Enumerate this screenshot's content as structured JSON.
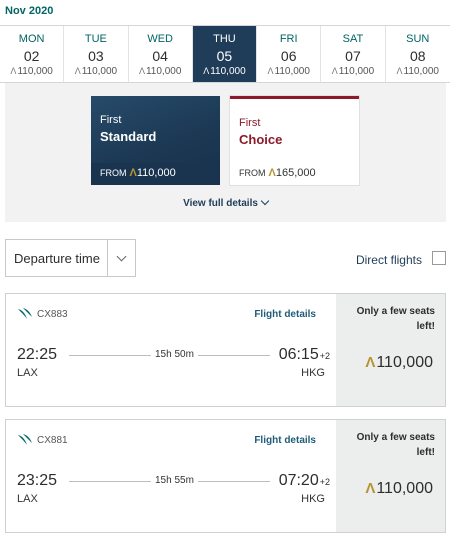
{
  "header": {
    "month": "Nov 2020"
  },
  "days": [
    {
      "dow": "MON",
      "date": "02",
      "price": "110,000",
      "selected": false
    },
    {
      "dow": "TUE",
      "date": "03",
      "price": "110,000",
      "selected": false
    },
    {
      "dow": "WED",
      "date": "04",
      "price": "110,000",
      "selected": false
    },
    {
      "dow": "THU",
      "date": "05",
      "price": "110,000",
      "selected": true
    },
    {
      "dow": "FRI",
      "date": "06",
      "price": "110,000",
      "selected": false
    },
    {
      "dow": "SAT",
      "date": "07",
      "price": "110,000",
      "selected": false
    },
    {
      "dow": "SUN",
      "date": "08",
      "price": "110,000",
      "selected": false
    }
  ],
  "currency_symbol": "Λ",
  "fares": [
    {
      "cabin": "First",
      "name": "Standard",
      "from_label": "FROM",
      "price": "110,000"
    },
    {
      "cabin": "First",
      "name": "Choice",
      "from_label": "FROM",
      "price": "165,000"
    }
  ],
  "full_details_label": "View full details",
  "sort": {
    "label": "Departure time"
  },
  "direct_flights": {
    "label": "Direct flights",
    "checked": false
  },
  "flights": [
    {
      "number": "CX883",
      "details_label": "Flight details",
      "dep_time": "22:25",
      "dep_code": "LAX",
      "duration": "15h 50m",
      "arr_time": "06:15",
      "arr_offset": "+2",
      "arr_code": "HKG",
      "availability": "Only a few seats left!",
      "price": "110,000"
    },
    {
      "number": "CX881",
      "details_label": "Flight details",
      "dep_time": "23:25",
      "dep_code": "LAX",
      "duration": "15h 55m",
      "arr_time": "07:20",
      "arr_offset": "+2",
      "arr_code": "HKG",
      "availability": "Only a few seats left!",
      "price": "110,000"
    }
  ],
  "colors": {
    "brand_teal": "#006564",
    "selected_navy": "#1f3d58",
    "choice_red": "#8c1a2a",
    "asia_miles_gold": "#b69531"
  },
  "icons": {
    "airline_logo": "cathay-brushwing-icon",
    "currency": "asia-miles-icon"
  }
}
